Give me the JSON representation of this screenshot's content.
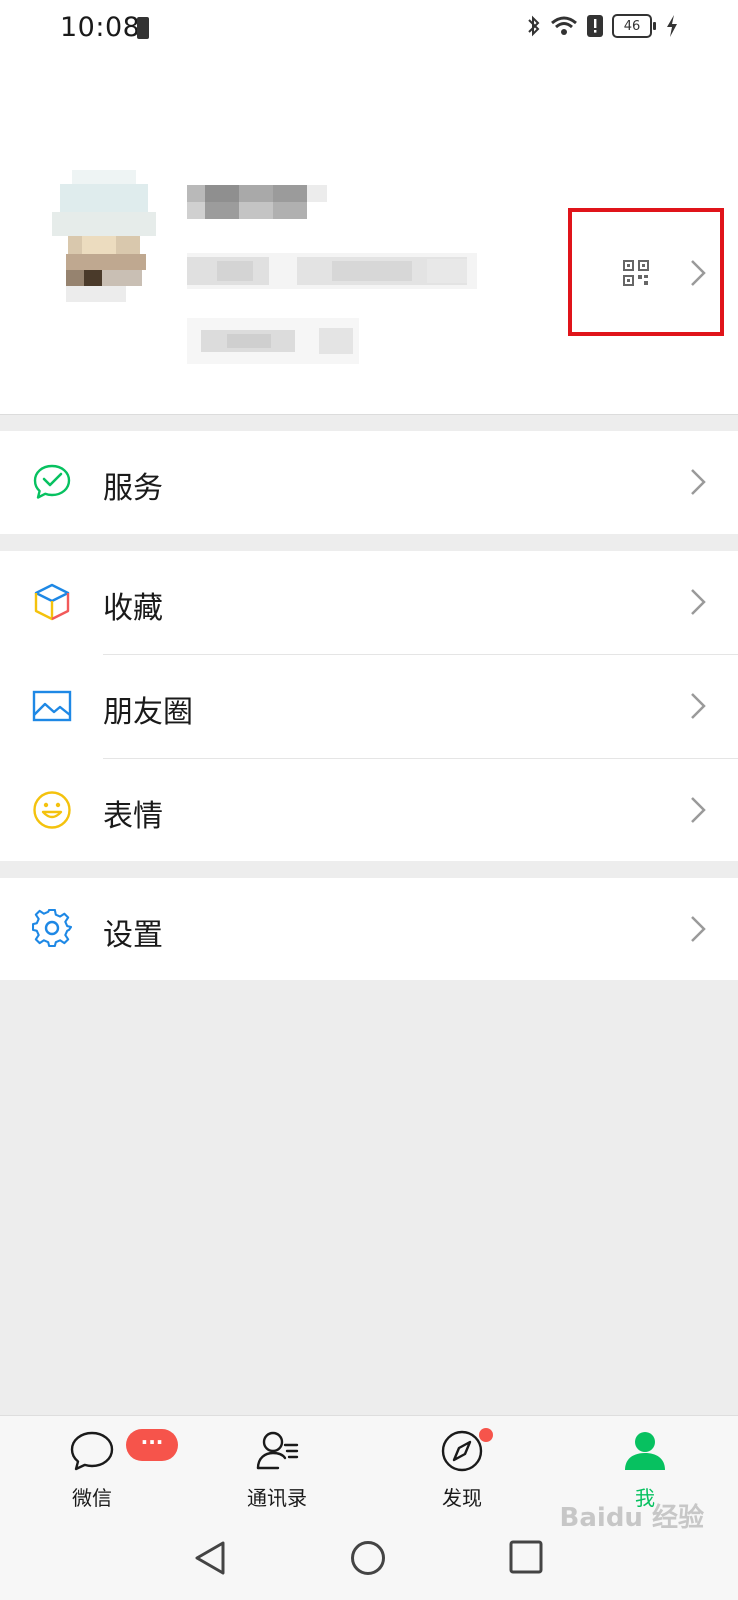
{
  "status_bar": {
    "time": "10:08",
    "battery": "46"
  },
  "profile": {
    "qr_icon": "qr-code-icon",
    "chevron_icon": "chevron-right-icon",
    "highlight_color": "#e0141a"
  },
  "menu": {
    "groups": [
      {
        "items": [
          {
            "label": "服务",
            "icon": "wechat-pay-icon",
            "color": "#07c160"
          }
        ]
      },
      {
        "items": [
          {
            "label": "收藏",
            "icon": "favorites-cube-icon",
            "color": "#1e88e5"
          },
          {
            "label": "朋友圈",
            "icon": "moments-photo-icon",
            "color": "#1e88e5"
          },
          {
            "label": "表情",
            "icon": "sticker-smile-icon",
            "color": "#f4c20d"
          }
        ]
      },
      {
        "items": [
          {
            "label": "设置",
            "icon": "settings-gear-icon",
            "color": "#1e88e5"
          }
        ]
      }
    ]
  },
  "tabbar": {
    "tabs": [
      {
        "label": "微信",
        "icon": "chat-bubble-icon",
        "badge": "···"
      },
      {
        "label": "通讯录",
        "icon": "contacts-icon"
      },
      {
        "label": "发现",
        "icon": "discover-compass-icon"
      },
      {
        "label": "我",
        "icon": "me-person-icon",
        "active": true
      }
    ],
    "active_color": "#07c160"
  },
  "navbar": {
    "buttons": [
      "back-icon",
      "home-icon",
      "recents-icon"
    ]
  },
  "watermark": "Baidu 经验"
}
